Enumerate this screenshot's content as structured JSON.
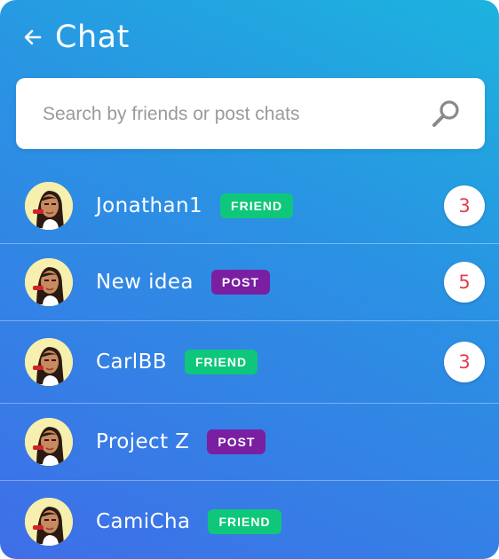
{
  "header": {
    "title": "Chat",
    "back_icon": "arrow-left-icon"
  },
  "search": {
    "placeholder": "Search by friends or post chats",
    "value": "",
    "icon": "search-icon"
  },
  "chats": [
    {
      "name": "Jonathan1",
      "tag": "FRIEND",
      "unread": "3"
    },
    {
      "name": "New idea",
      "tag": "POST",
      "unread": "5"
    },
    {
      "name": "CarlBB",
      "tag": "FRIEND",
      "unread": "3"
    },
    {
      "name": "Project Z",
      "tag": "POST",
      "unread": ""
    },
    {
      "name": "CamiCha",
      "tag": "FRIEND",
      "unread": ""
    }
  ],
  "colors": {
    "gradient_top": "#1cb3de",
    "gradient_bottom": "#3f6ee8",
    "friend_tag": "#0fc77a",
    "post_tag": "#7a1fa2",
    "unread_text": "#e23d52"
  }
}
